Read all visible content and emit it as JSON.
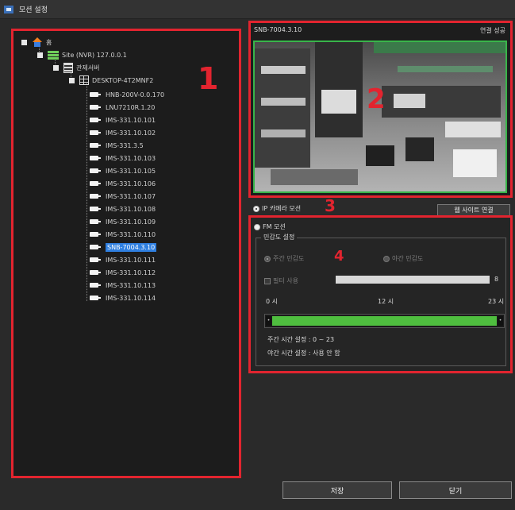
{
  "window": {
    "title": "모션 설정"
  },
  "tree": {
    "root": "홈",
    "site": "Site (NVR) 127.0.0.1",
    "server_group": "관제서버",
    "desktop": "DESKTOP-4T2MNF2",
    "cameras": [
      "HNB-200V-0.0.170",
      "LNU7210R.1.20",
      "IMS-331.10.101",
      "IMS-331.10.102",
      "IMS-331.3.5",
      "IMS-331.10.103",
      "IMS-331.10.105",
      "IMS-331.10.106",
      "IMS-331.10.107",
      "IMS-331.10.108",
      "IMS-331.10.109",
      "IMS-331.10.110",
      "SNB-7004.3.10",
      "IMS-331.10.111",
      "IMS-331.10.112",
      "IMS-331.10.113",
      "IMS-331.10.114"
    ],
    "selected_camera": "SNB-7004.3.10"
  },
  "callouts": {
    "one": "1",
    "two": "2",
    "three": "3",
    "four": "4"
  },
  "video": {
    "camera_name": "SNB-7004.3.10",
    "status": "연결 성공"
  },
  "ip_mode": {
    "label": "IP 카메라 모션",
    "website_button": "웹 사이트 연결",
    "selected": true
  },
  "fm_mode": {
    "label": "FM 모션",
    "selected": false
  },
  "sensitivity": {
    "group_title": "민감도 설정",
    "day_label": "주간 민감도",
    "night_label": "야간 민감도",
    "filter_label": "필터 사용",
    "filter_value": "8",
    "time_start": "0 시",
    "time_mid": "12 시",
    "time_end": "23 시",
    "day_range_text": "주간 시간 설정 : 0 ~ 23",
    "night_range_text": "야간 시간 설정 : 사용 안 함",
    "day_active_fraction": 1.0
  },
  "buttons": {
    "save": "저장",
    "close": "닫기"
  },
  "colors": {
    "accent_red": "#e2242f",
    "green": "#4fbe3f",
    "selection": "#2f7fe0"
  }
}
